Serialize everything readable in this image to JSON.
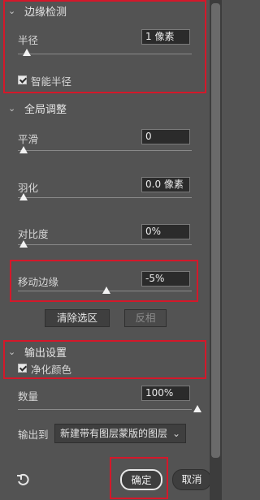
{
  "edge_detection": {
    "title": "边缘检测",
    "radius": {
      "label": "半径",
      "value": "1 像素",
      "slider_level": 0.02
    },
    "smart_radius": {
      "label": "智能半径",
      "checked": true
    }
  },
  "global_adjust": {
    "title": "全局调整",
    "smooth": {
      "label": "平滑",
      "value": "0",
      "slider_level": 0
    },
    "feather": {
      "label": "羽化",
      "value": "0.0 像素",
      "slider_level": 0
    },
    "contrast": {
      "label": "对比度",
      "value": "0%",
      "slider_level": 0
    },
    "shift_edge": {
      "label": "移动边缘",
      "value": "-5%",
      "slider_level": 0.475
    },
    "clear_selection_label": "清除选区",
    "invert_label": "反相"
  },
  "output_settings": {
    "title": "输出设置",
    "decontaminate": {
      "label": "净化颜色",
      "checked": true
    },
    "amount": {
      "label": "数量",
      "value": "100%",
      "slider_level": 1.0
    },
    "output_to": {
      "label": "输出到",
      "selected": "新建带有图层蒙版的图层"
    }
  },
  "footer": {
    "ok_label": "确定",
    "cancel_label": "取消"
  },
  "icons": {
    "chevron": "chevron-down-icon",
    "checkbox": "checkbox-checked-icon",
    "reset": "reset-icon"
  },
  "colors": {
    "panel_bg": "#535353",
    "highlight_red": "#d4182a"
  }
}
